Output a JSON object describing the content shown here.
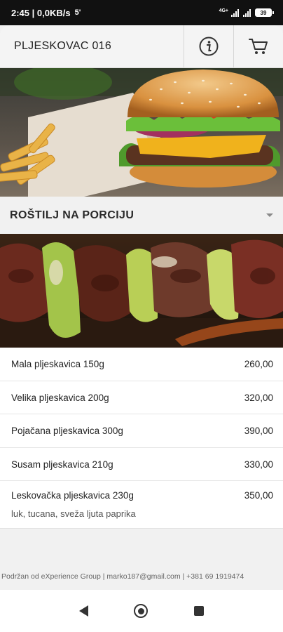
{
  "status_bar": {
    "time": "2:45",
    "network_speed": "0,0KB/s",
    "extra_indicator": "5'",
    "network_type": "4G+",
    "battery": "39"
  },
  "header": {
    "title": "PLJESKOVAC 016",
    "info_icon": "info-icon",
    "cart_icon": "cart-icon"
  },
  "category": {
    "title": "ROŠTILJ NA PORCIJU",
    "expanded_icon": "chevron-down-icon"
  },
  "menu": {
    "items": [
      {
        "name": "Mala pljeskavica 150g",
        "price": "260,00",
        "description": ""
      },
      {
        "name": "Velika pljeskavica 200g",
        "price": "320,00",
        "description": ""
      },
      {
        "name": "Pojačana pljeskavica 300g",
        "price": "390,00",
        "description": ""
      },
      {
        "name": "Susam pljeskavica 210g",
        "price": "330,00",
        "description": ""
      },
      {
        "name": "Leskovačka pljeskavica 230g",
        "price": "350,00",
        "description": "luk, tucana, sveža ljuta paprika"
      }
    ]
  },
  "footer": {
    "text": "Podržan od eXperience Group | marko187@gmail.com | +381 69 1919474"
  },
  "colors": {
    "status_bar_bg": "#111111",
    "header_bg": "#f4f4f4",
    "list_bg": "#ffffff",
    "page_bg": "#f1f1f1"
  }
}
